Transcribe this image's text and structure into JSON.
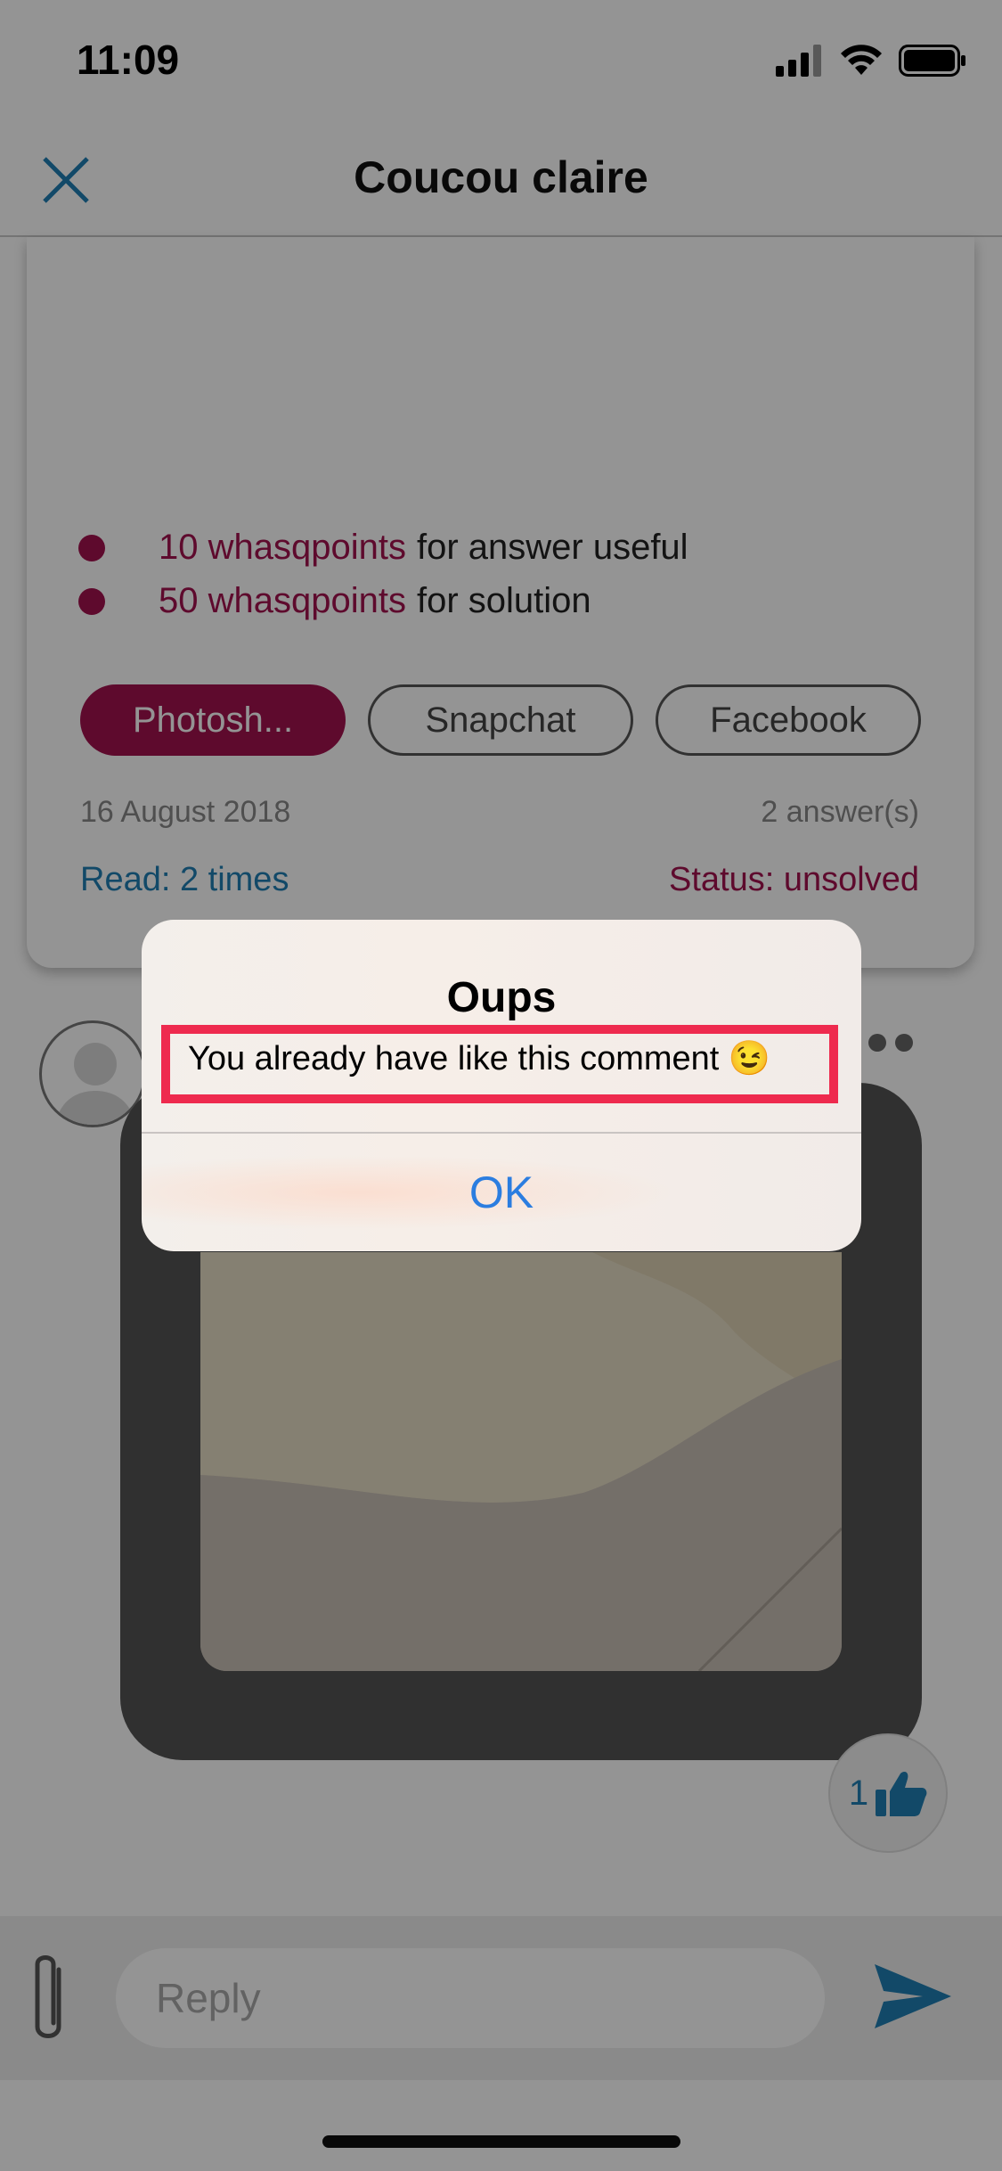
{
  "status_bar": {
    "time": "11:09"
  },
  "nav": {
    "title": "Coucou claire"
  },
  "question": {
    "rewards": [
      {
        "points": "10 whasqpoints",
        "text": "for answer useful"
      },
      {
        "points": "50 whasqpoints",
        "text": "for solution"
      }
    ],
    "tags": [
      {
        "label": "Photosh...",
        "active": true
      },
      {
        "label": "Snapchat",
        "active": false
      },
      {
        "label": "Facebook",
        "active": false
      }
    ],
    "date": "16 August 2018",
    "answers": "2 answer(s)",
    "read": "Read: 2 times",
    "status": "Status: unsolved"
  },
  "answer": {
    "like_count": "1"
  },
  "reply": {
    "placeholder": "Reply"
  },
  "alert": {
    "title": "Oups",
    "message": "You already have like this comment 😉",
    "ok_label": "OK"
  },
  "colors": {
    "accent": "#a3124f",
    "link_blue": "#1f7fb3",
    "ios_blue": "#2b7de0",
    "highlight_red": "#ee2a4e"
  }
}
